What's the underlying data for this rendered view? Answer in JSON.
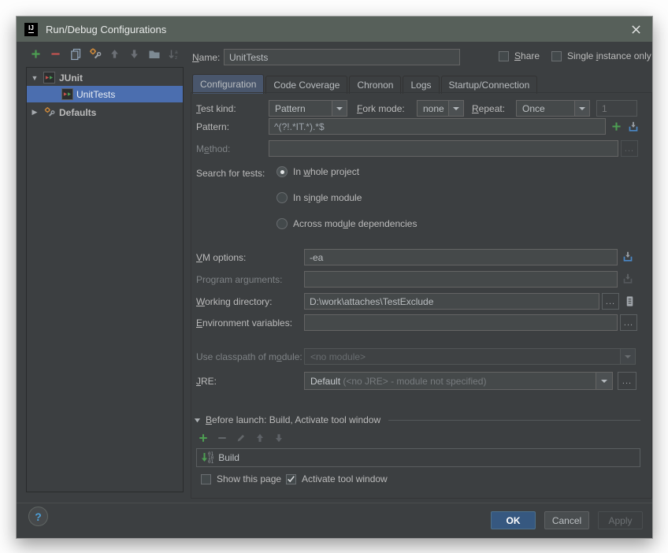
{
  "window": {
    "title": "Run/Debug Configurations",
    "logo_text": "IJ"
  },
  "left_toolbar": {
    "icons": [
      "add",
      "remove",
      "copy",
      "edit-defaults",
      "move-up",
      "move-down",
      "folder",
      "sort-alphabetically"
    ]
  },
  "tree": {
    "items": [
      {
        "label": "JUnit",
        "expanded": true
      },
      {
        "label": "UnitTests",
        "selected": true
      },
      {
        "label": "Defaults",
        "expanded": false
      }
    ]
  },
  "header": {
    "name_label": {
      "t": "Name:",
      "u": 0
    },
    "name_value": "UnitTests",
    "share": {
      "label": {
        "t": "Share",
        "u": 0
      },
      "checked": false
    },
    "single_instance": {
      "label": {
        "t": "Single instance only",
        "u": 7
      },
      "checked": false
    }
  },
  "tabs": {
    "items": [
      "Configuration",
      "Code Coverage",
      "Chronon",
      "Logs",
      "Startup/Connection"
    ],
    "selected": "Configuration"
  },
  "config": {
    "test_kind": {
      "label": {
        "t": "Test kind:",
        "u": 0
      },
      "value": "Pattern"
    },
    "fork_mode": {
      "label": {
        "t": "Fork mode:",
        "u": 0
      },
      "value": "none"
    },
    "repeat": {
      "label": {
        "t": "Repeat:",
        "u": 0
      },
      "value": "Once",
      "count": "1"
    },
    "pattern": {
      "label": {
        "t": "Pattern:"
      },
      "value": "^(?!.*IT.*).*$"
    },
    "method": {
      "label": {
        "t": "Method:",
        "u": 1
      },
      "value": ""
    },
    "search_for_tests": {
      "label": {
        "t": "Search for tests:"
      },
      "options": [
        {
          "label": {
            "t": "In whole project",
            "u": 3
          },
          "selected": true
        },
        {
          "label": {
            "t": "In single module",
            "u": 4
          },
          "selected": false
        },
        {
          "label": {
            "t": "Across module dependencies",
            "u": 10
          },
          "selected": false
        }
      ]
    },
    "vm_options": {
      "label": {
        "t": "VM options:",
        "u": 0
      },
      "value": "-ea"
    },
    "program_arguments": {
      "label": {
        "t": "Program arguments:",
        "u": 10
      },
      "value": ""
    },
    "working_directory": {
      "label": {
        "t": "Working directory:",
        "u": 0
      },
      "value": "D:\\work\\attaches\\TestExclude"
    },
    "environment_variables": {
      "label": {
        "t": "Environment variables:",
        "u": 0
      },
      "value": ""
    },
    "use_classpath": {
      "label": {
        "t": "Use classpath of module:",
        "u": 18
      },
      "value": "<no module>"
    },
    "jre": {
      "label": {
        "t": "JRE:",
        "u": 0
      },
      "value_main": "Default",
      "value_note": "(<no JRE> - module not specified)"
    }
  },
  "before_launch": {
    "header": {
      "t": "Before launch: Build, Activate tool window",
      "u": 0
    },
    "toolbar_icons": [
      "add",
      "remove",
      "edit",
      "move-up",
      "move-down"
    ],
    "items": [
      {
        "icon": "build-icon",
        "label": "Build",
        "icon_digits": [
          "01",
          "10",
          "01"
        ]
      }
    ],
    "show_this_page": {
      "label": "Show this page",
      "checked": false
    },
    "activate_tool_window": {
      "label": "Activate tool window",
      "checked": true
    }
  },
  "footer": {
    "ok": "OK",
    "cancel": "Cancel",
    "apply": "Apply",
    "help": "?"
  },
  "colors": {
    "dialog_bg": "#3c3f41",
    "titlebar": "#57605a",
    "selection_blue": "#4b6eaf",
    "selected_tab": "#49566c",
    "ok_button": "#365880",
    "add_green": "#4d9e52",
    "remove_red": "#c75450",
    "expand_box_blue": "#4a88c7",
    "field_bg": "#45494a",
    "field_border": "#646464"
  }
}
